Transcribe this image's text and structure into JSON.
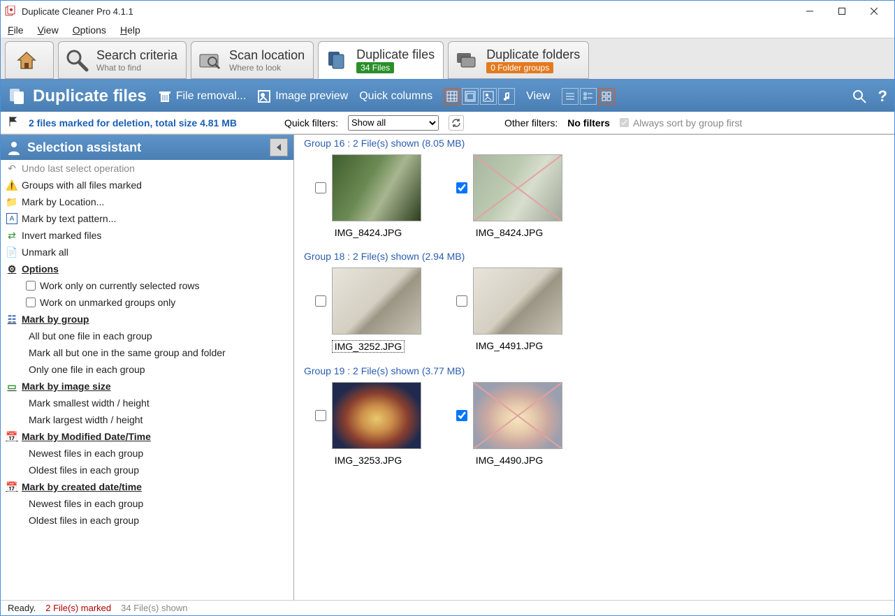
{
  "window": {
    "title": "Duplicate Cleaner Pro 4.1.1"
  },
  "menu": {
    "file": "File",
    "view": "View",
    "options": "Options",
    "help": "Help"
  },
  "tabs": {
    "search": {
      "label": "Search criteria",
      "sub": "What to find"
    },
    "scan": {
      "label": "Scan location",
      "sub": "Where to look"
    },
    "dfiles": {
      "label": "Duplicate files",
      "badge": "34 Files"
    },
    "dfolders": {
      "label": "Duplicate folders",
      "badge": "0 Folder groups"
    }
  },
  "bluebar": {
    "title": "Duplicate files",
    "file_removal": "File removal...",
    "image_preview": "Image preview",
    "quick_columns": "Quick columns",
    "view": "View"
  },
  "filters": {
    "marked_text": "2 files marked for deletion, total size 4.81 MB",
    "quick_label": "Quick filters:",
    "show_all": "Show all",
    "other_label": "Other filters:",
    "no_filters": "No filters",
    "always_sort": "Always sort by group first"
  },
  "selection": {
    "title": "Selection assistant",
    "undo": "Undo last select operation",
    "groups_all": "Groups with all files marked",
    "mark_loc": "Mark by Location...",
    "mark_text": "Mark by text pattern...",
    "invert": "Invert marked files",
    "unmark": "Unmark all",
    "options": "Options",
    "opt1": "Work only on currently selected rows",
    "opt2": "Work on unmarked groups only",
    "mgroup": "Mark by group",
    "mg1": "All but one file in each group",
    "mg2": "Mark all but one in the same group and folder",
    "mg3": "Only one file in each group",
    "mimg": "Mark by image size",
    "mi1": "Mark smallest width / height",
    "mi2": "Mark largest width / height",
    "mdate": "Mark by Modified Date/Time",
    "md1": "Newest files in each group",
    "md2": "Oldest files in each group",
    "mcdate": "Mark by created date/time",
    "mc1": "Newest files in each group",
    "mc2": "Oldest files in each group"
  },
  "groups": [
    {
      "header": "Group 16  :  2 File(s) shown (8.05 MB)",
      "bg": "bg1",
      "files": [
        {
          "name": "IMG_8424.JPG",
          "checked": false,
          "sel": false
        },
        {
          "name": "IMG_8424.JPG",
          "checked": true,
          "sel": false
        }
      ]
    },
    {
      "header": "Group 18  :  2 File(s) shown (2.94 MB)",
      "bg": "bg2",
      "files": [
        {
          "name": "IMG_3252.JPG",
          "checked": false,
          "sel": true
        },
        {
          "name": "IMG_4491.JPG",
          "checked": false,
          "sel": false
        }
      ]
    },
    {
      "header": "Group 19  :  2 File(s) shown (3.77 MB)",
      "bg": "bg3",
      "files": [
        {
          "name": "IMG_3253.JPG",
          "checked": false,
          "sel": false
        },
        {
          "name": "IMG_4490.JPG",
          "checked": true,
          "sel": false
        }
      ]
    }
  ],
  "status": {
    "ready": "Ready.",
    "marked": "2 File(s) marked",
    "shown": "34 File(s) shown"
  }
}
